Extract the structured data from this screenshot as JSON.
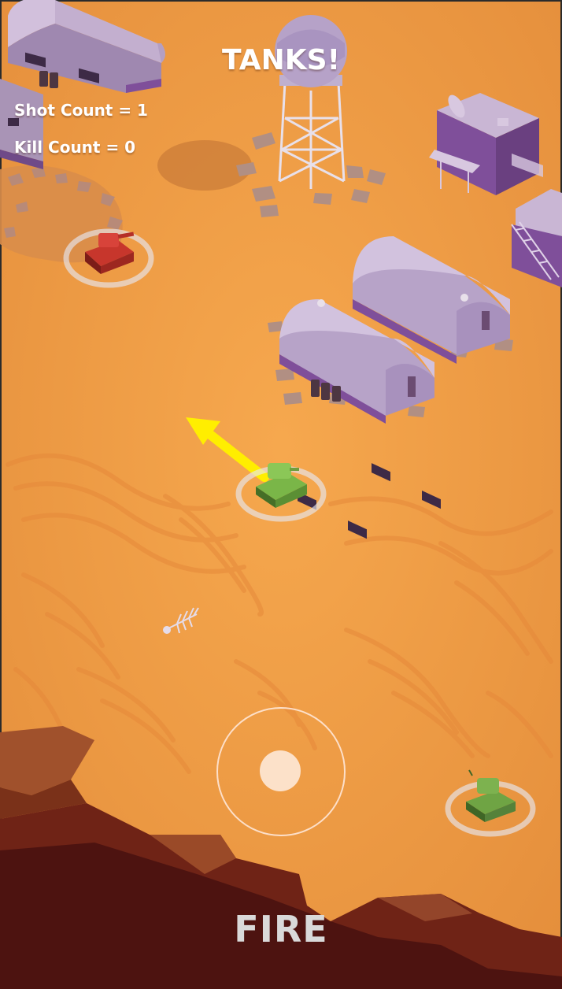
{
  "hud": {
    "title": "TANKS!",
    "shot_count": "Shot Count = 1",
    "kill_count": "Kill Count = 0",
    "fire_label": "FIRE"
  },
  "colors": {
    "desert": "#f3a24a",
    "desert_shadow": "#e08a3a",
    "building": "#b7a3c3",
    "building_dark": "#7f4f9a",
    "player_tank": "#7ab648",
    "enemy_tank_red": "#c7362c",
    "enemy_tank_green": "#6fa444",
    "aim_arrow": "#ffee00",
    "cliff": "#8a3b1f",
    "cliff_dark": "#5a1410"
  },
  "icons": {
    "player": "green-tank-icon",
    "enemy_red": "red-tank-icon",
    "enemy_green": "green-tank-icon",
    "arrow": "aim-arrow-icon"
  }
}
